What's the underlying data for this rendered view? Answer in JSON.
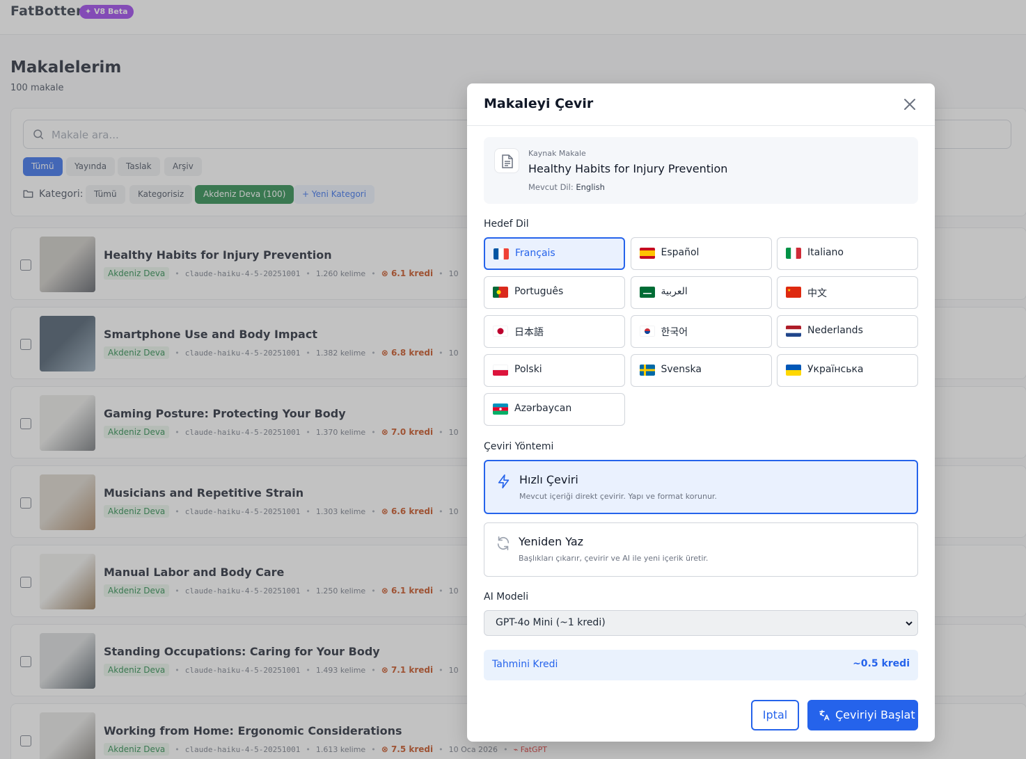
{
  "app": {
    "brand": "FatBotter",
    "beta_badge": "V8 Beta"
  },
  "page": {
    "title": "Makalelerim",
    "count": "100 makale"
  },
  "filters": {
    "search_placeholder": "Makale ara...",
    "status_tabs": [
      "Tümü",
      "Yayında",
      "Taslak",
      "Arşiv"
    ],
    "category_label": "Kategori:",
    "categories": [
      "Tümü",
      "Kategorisiz",
      "Akdeniz Deva (100)"
    ],
    "new_category": "+ Yeni Kategori"
  },
  "articles": [
    {
      "title": "Healthy Habits for Injury Prevention",
      "category": "Akdeniz Deva",
      "model": "claude-haiku-4-5-20251001",
      "words": "1.260 kelime",
      "credit": "6.1 kredi",
      "extra": "10"
    },
    {
      "title": "Smartphone Use and Body Impact",
      "category": "Akdeniz Deva",
      "model": "claude-haiku-4-5-20251001",
      "words": "1.382 kelime",
      "credit": "6.8 kredi",
      "extra": "10"
    },
    {
      "title": "Gaming Posture: Protecting Your Body",
      "category": "Akdeniz Deva",
      "model": "claude-haiku-4-5-20251001",
      "words": "1.370 kelime",
      "credit": "7.0 kredi",
      "extra": "10"
    },
    {
      "title": "Musicians and Repetitive Strain",
      "category": "Akdeniz Deva",
      "model": "claude-haiku-4-5-20251001",
      "words": "1.303 kelime",
      "credit": "6.6 kredi",
      "extra": "10"
    },
    {
      "title": "Manual Labor and Body Care",
      "category": "Akdeniz Deva",
      "model": "claude-haiku-4-5-20251001",
      "words": "1.250 kelime",
      "credit": "6.1 kredi",
      "extra": "10"
    },
    {
      "title": "Standing Occupations: Caring for Your Body",
      "category": "Akdeniz Deva",
      "model": "claude-haiku-4-5-20251001",
      "words": "1.493 kelime",
      "credit": "7.1 kredi",
      "extra": "10"
    },
    {
      "title": "Working from Home: Ergonomic Considerations",
      "category": "Akdeniz Deva",
      "model": "claude-haiku-4-5-20251001",
      "words": "1.613 kelime",
      "credit": "7.5 kredi",
      "extra": "10 Oca 2026",
      "source": "FatGPT"
    }
  ],
  "modal": {
    "title": "Makaleyi Çevir",
    "source_label": "Kaynak Makale",
    "source_title": "Healthy Habits for Injury Prevention",
    "current_lang_label": "Mevcut Dil:",
    "current_lang": "English",
    "target_label": "Hedef Dil",
    "languages": [
      "Français",
      "Español",
      "Italiano",
      "Português",
      "العربية",
      "中文",
      "日本語",
      "한국어",
      "Nederlands",
      "Polski",
      "Svenska",
      "Українська",
      "Azərbaycan"
    ],
    "selected_language": "Français",
    "method_label": "Çeviri Yöntemi",
    "methods": [
      {
        "name": "Hızlı Çeviri",
        "desc": "Mevcut içeriği direkt çevirir. Yapı ve format korunur."
      },
      {
        "name": "Yeniden Yaz",
        "desc": "Başlıkları çıkarır, çevirir ve AI ile yeni içerik üretir."
      }
    ],
    "model_label": "AI Modeli",
    "model_value": "GPT-4o Mini (~1 kredi)",
    "estimate_label": "Tahmini Kredi",
    "estimate_value": "~0.5 kredi",
    "cancel": "Iptal",
    "start": "Çeviriyi Başlat"
  },
  "colors": {
    "primary": "#2563eb",
    "success": "#15803d",
    "accent": "#9333ea",
    "credit": "#c2410c"
  }
}
